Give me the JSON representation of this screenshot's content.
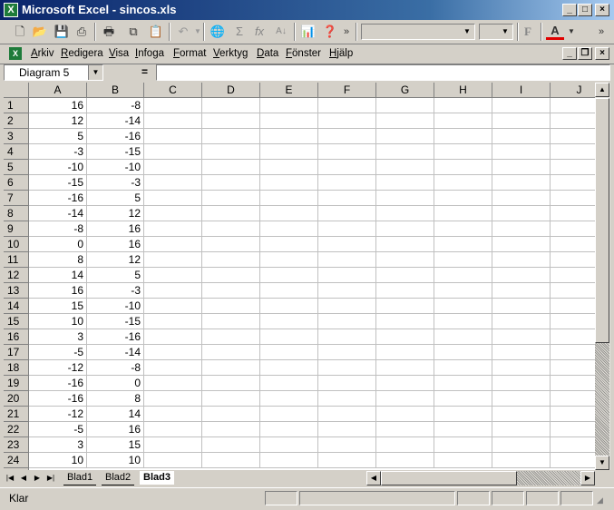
{
  "window": {
    "title": "Microsoft Excel - sincos.xls"
  },
  "menu": [
    "Arkiv",
    "Redigera",
    "Visa",
    "Infoga",
    "Format",
    "Verktyg",
    "Data",
    "Fönster",
    "Hjälp"
  ],
  "formula_bar": {
    "name_box": "Diagram 5",
    "equals": "=",
    "formula": ""
  },
  "columns": [
    "A",
    "B",
    "C",
    "D",
    "E",
    "F",
    "G",
    "H",
    "I",
    "J"
  ],
  "rows": [
    {
      "n": "1",
      "a": "16",
      "b": "-8"
    },
    {
      "n": "2",
      "a": "12",
      "b": "-14"
    },
    {
      "n": "3",
      "a": "5",
      "b": "-16"
    },
    {
      "n": "4",
      "a": "-3",
      "b": "-15"
    },
    {
      "n": "5",
      "a": "-10",
      "b": "-10"
    },
    {
      "n": "6",
      "a": "-15",
      "b": "-3"
    },
    {
      "n": "7",
      "a": "-16",
      "b": "5"
    },
    {
      "n": "8",
      "a": "-14",
      "b": "12"
    },
    {
      "n": "9",
      "a": "-8",
      "b": "16"
    },
    {
      "n": "10",
      "a": "0",
      "b": "16"
    },
    {
      "n": "11",
      "a": "8",
      "b": "12"
    },
    {
      "n": "12",
      "a": "14",
      "b": "5"
    },
    {
      "n": "13",
      "a": "16",
      "b": "-3"
    },
    {
      "n": "14",
      "a": "15",
      "b": "-10"
    },
    {
      "n": "15",
      "a": "10",
      "b": "-15"
    },
    {
      "n": "16",
      "a": "3",
      "b": "-16"
    },
    {
      "n": "17",
      "a": "-5",
      "b": "-14"
    },
    {
      "n": "18",
      "a": "-12",
      "b": "-8"
    },
    {
      "n": "19",
      "a": "-16",
      "b": "0"
    },
    {
      "n": "20",
      "a": "-16",
      "b": "8"
    },
    {
      "n": "21",
      "a": "-12",
      "b": "14"
    },
    {
      "n": "22",
      "a": "-5",
      "b": "16"
    },
    {
      "n": "23",
      "a": "3",
      "b": "15"
    },
    {
      "n": "24",
      "a": "10",
      "b": "10"
    }
  ],
  "sheets": [
    {
      "name": "Blad1",
      "active": false
    },
    {
      "name": "Blad2",
      "active": false
    },
    {
      "name": "Blad3",
      "active": true
    }
  ],
  "status": {
    "text": "Klar"
  },
  "toolbar": {
    "more": "»",
    "bold": "F",
    "font_color_letter": "A"
  }
}
